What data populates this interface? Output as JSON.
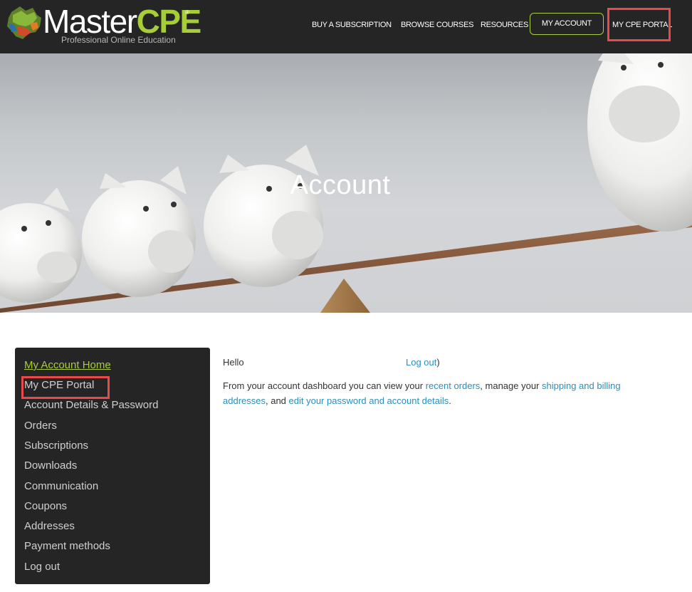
{
  "header": {
    "logo": {
      "brand_master": "Master",
      "brand_cpe": "CPE",
      "registered": "®",
      "tagline": "Professional Online Education"
    },
    "nav": {
      "buy_subscription": "BUY A SUBSCRIPTION",
      "browse_courses": "BROWSE COURSES",
      "resources": "RESOURCES",
      "my_account": "MY ACCOUNT",
      "my_cpe_portal": "MY CPE PORTAL"
    }
  },
  "hero": {
    "title": "Account"
  },
  "sidebar": {
    "items": [
      {
        "label": "My Account Home"
      },
      {
        "label": "My CPE Portal"
      },
      {
        "label": "Account Details & Password"
      },
      {
        "label": "Orders"
      },
      {
        "label": "Subscriptions"
      },
      {
        "label": "Downloads"
      },
      {
        "label": "Communication"
      },
      {
        "label": "Coupons"
      },
      {
        "label": "Addresses"
      },
      {
        "label": "Payment methods"
      },
      {
        "label": "Log out"
      }
    ]
  },
  "main": {
    "hello": "Hello",
    "logout_link": "Log out",
    "logout_close": ")",
    "dashboard_intro": "From your account dashboard you can view your ",
    "recent_orders_link": "recent orders",
    "manage_text": ", manage your ",
    "shipping_link_part1": "shipping and billing",
    "shipping_link_part2": "addresses",
    "and_text": ", and ",
    "edit_link": "edit your password and account details",
    "period": "."
  },
  "colors": {
    "header_bg": "#252525",
    "accent_green": "#a6ce39",
    "link_blue": "#2a8fbd",
    "highlight_red": "#e84a4a"
  }
}
